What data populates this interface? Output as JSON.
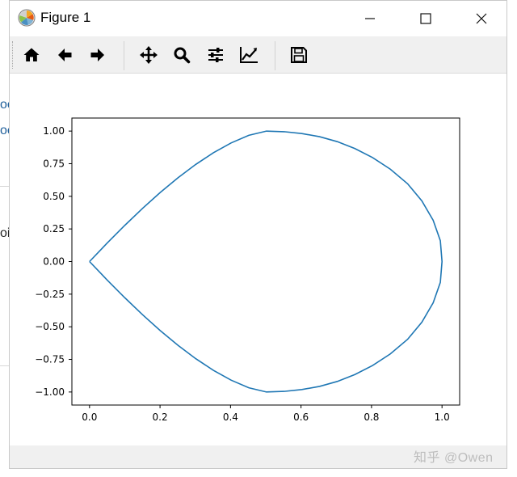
{
  "window": {
    "title": "Figure 1"
  },
  "background_fragments": [
    {
      "text": "oc",
      "kind": "link"
    },
    {
      "text": "oc",
      "kind": "link"
    },
    {
      "text": "oi",
      "kind": "text"
    }
  ],
  "toolbar": {
    "buttons": [
      {
        "name": "home",
        "icon": "home-icon"
      },
      {
        "name": "back",
        "icon": "arrow-left-icon"
      },
      {
        "name": "forward",
        "icon": "arrow-right-icon"
      },
      {
        "name": "pan",
        "icon": "move-icon"
      },
      {
        "name": "zoom",
        "icon": "magnifier-icon"
      },
      {
        "name": "configure-subplots",
        "icon": "sliders-icon"
      },
      {
        "name": "edit-axis",
        "icon": "line-chart-icon"
      },
      {
        "name": "save",
        "icon": "floppy-disk-icon"
      }
    ]
  },
  "chart_data": {
    "type": "line",
    "title": "",
    "xlabel": "",
    "ylabel": "",
    "xlim": [
      -0.05,
      1.05
    ],
    "ylim": [
      -1.1,
      1.1
    ],
    "xticks": [
      0.0,
      0.2,
      0.4,
      0.6,
      0.8,
      1.0
    ],
    "xtick_labels": [
      "0.0",
      "0.2",
      "0.4",
      "0.6",
      "0.8",
      "1.0"
    ],
    "yticks": [
      1.0,
      0.75,
      0.5,
      0.25,
      0.0,
      -0.25,
      -0.5,
      -0.75,
      -1.0
    ],
    "ytick_labels": [
      "1.00",
      "0.75",
      "0.50",
      "0.25",
      "0.00",
      "−0.25",
      "−0.50",
      "−0.75",
      "−1.00"
    ],
    "grid": false,
    "series": [
      {
        "color": "#1f77b4",
        "x": [
          0.0,
          0.0502,
          0.1004,
          0.1506,
          0.2008,
          0.251,
          0.3012,
          0.3514,
          0.4016,
          0.4518,
          0.502,
          0.5522,
          0.6024,
          0.6526,
          0.7028,
          0.7529,
          0.8031,
          0.8533,
          0.9023,
          0.9428,
          0.9749,
          0.9952,
          1.0,
          0.9952,
          0.9749,
          0.9428,
          0.9023,
          0.8533,
          0.8031,
          0.7529,
          0.7028,
          0.6526,
          0.6024,
          0.5522,
          0.502,
          0.4518,
          0.4016,
          0.3514,
          0.3012,
          0.251,
          0.2008,
          0.1506,
          0.1004,
          0.0502,
          0.0
        ],
        "y": [
          0.0,
          0.1419,
          0.2782,
          0.4079,
          0.5297,
          0.6423,
          0.7442,
          0.8337,
          0.9091,
          0.9678,
          1.0,
          0.9953,
          0.9812,
          0.9571,
          0.9191,
          0.8662,
          0.7966,
          0.7081,
          0.5963,
          0.4647,
          0.3163,
          0.1598,
          0.0,
          -0.1598,
          -0.3163,
          -0.4647,
          -0.5963,
          -0.7081,
          -0.7966,
          -0.8662,
          -0.9191,
          -0.9571,
          -0.9812,
          -0.9953,
          -1.0,
          -0.9678,
          -0.9091,
          -0.8337,
          -0.7442,
          -0.6423,
          -0.5297,
          -0.4079,
          -0.2782,
          -0.1419,
          0.0
        ]
      }
    ]
  },
  "watermark": "知乎 @Owen"
}
